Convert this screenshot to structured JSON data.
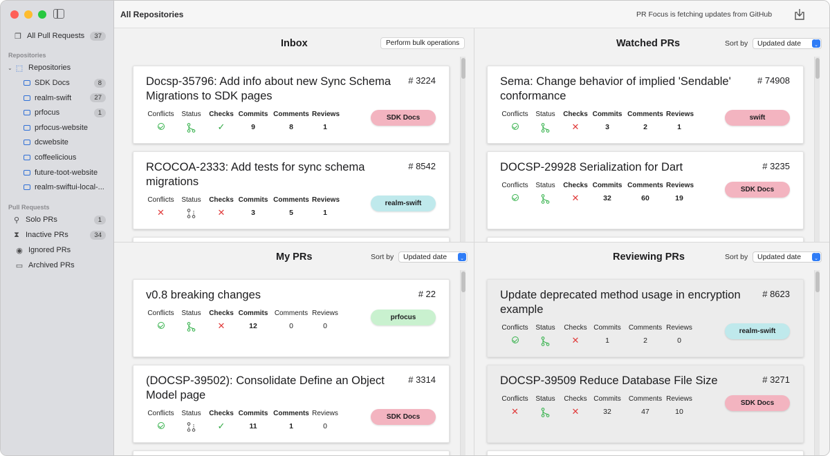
{
  "sidebar": {
    "all_pull_requests": {
      "label": "All Pull Requests",
      "count": "37"
    },
    "section_repositories": "Repositories",
    "repositories_group": "Repositories",
    "repos": [
      {
        "label": "SDK Docs",
        "count": "8"
      },
      {
        "label": "realm-swift",
        "count": "27"
      },
      {
        "label": "prfocus",
        "count": "1"
      },
      {
        "label": "prfocus-website",
        "count": ""
      },
      {
        "label": "dcwebsite",
        "count": ""
      },
      {
        "label": "coffeelicious",
        "count": ""
      },
      {
        "label": "future-toot-website",
        "count": ""
      },
      {
        "label": "realm-swiftui-local-...",
        "count": ""
      }
    ],
    "section_pull_requests": "Pull Requests",
    "pr_filters": [
      {
        "label": "Solo PRs",
        "count": "1",
        "icon": "person-icon"
      },
      {
        "label": "Inactive PRs",
        "count": "34",
        "icon": "hourglass-icon"
      },
      {
        "label": "Ignored PRs",
        "count": "",
        "icon": "eye-icon"
      },
      {
        "label": "Archived PRs",
        "count": "",
        "icon": "archive-box-icon"
      }
    ]
  },
  "toolbar": {
    "title": "All Repositories",
    "status": "PR Focus is fetching updates from GitHub"
  },
  "labels": {
    "conflicts": "Conflicts",
    "status": "Status",
    "checks": "Checks",
    "commits": "Commits",
    "comments": "Comments",
    "reviews": "Reviews",
    "sort_by": "Sort by",
    "sort_value": "Updated date"
  },
  "panels": {
    "inbox": {
      "title": "Inbox",
      "bulk_button": "Perform bulk operations",
      "cards": [
        {
          "title": "Docsp-35796: Add info about new Sync Schema Migrations to SDK pages",
          "number": "# 3224",
          "commits": "9",
          "comments": "8",
          "reviews": "1",
          "repo": "SDK Docs"
        },
        {
          "title": "RCOCOA-2333: Add tests for sync schema migrations",
          "number": "# 8542",
          "commits": "3",
          "comments": "5",
          "reviews": "1",
          "repo": "realm-swift"
        }
      ]
    },
    "watched": {
      "title": "Watched PRs",
      "cards": [
        {
          "title": "Sema: Change behavior of implied 'Sendable' conformance",
          "number": "# 74908",
          "commits": "3",
          "comments": "2",
          "reviews": "1",
          "repo": "swift"
        },
        {
          "title": "DOCSP-29928 Serialization for Dart",
          "number": "# 3235",
          "commits": "32",
          "comments": "60",
          "reviews": "19",
          "repo": "SDK Docs"
        }
      ]
    },
    "my": {
      "title": "My PRs",
      "cards": [
        {
          "title": "v0.8 breaking changes",
          "number": "# 22",
          "commits": "12",
          "comments": "0",
          "reviews": "0",
          "repo": "prfocus"
        },
        {
          "title": "(DOCSP-39502): Consolidate Define an Object Model page",
          "number": "# 3314",
          "commits": "11",
          "comments": "1",
          "reviews": "0",
          "repo": "SDK Docs"
        }
      ]
    },
    "reviewing": {
      "title": "Reviewing PRs",
      "cards": [
        {
          "title": "Update deprecated method usage in encryption example",
          "number": "# 8623",
          "commits": "1",
          "comments": "2",
          "reviews": "0",
          "repo": "realm-swift"
        },
        {
          "title": "DOCSP-39509 Reduce Database File Size",
          "number": "# 3271",
          "commits": "32",
          "comments": "47",
          "reviews": "10",
          "repo": "SDK Docs"
        }
      ]
    }
  },
  "colors": {
    "sdk_docs_pill": "#f3b4c0",
    "realm_swift_pill": "#bfe9ec",
    "swift_pill": "#f3b4c0",
    "prfocus_pill": "#c9f1cf",
    "check_green": "#37b24d",
    "x_red": "#e03b3b"
  }
}
